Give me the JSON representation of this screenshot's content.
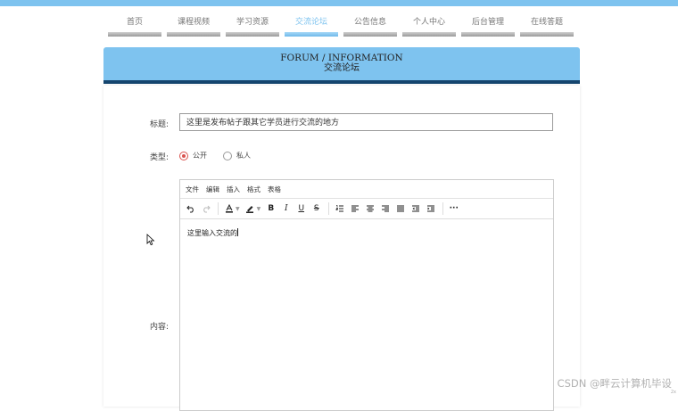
{
  "nav": {
    "items": [
      {
        "label": "首页",
        "active": false
      },
      {
        "label": "课程视频",
        "active": false
      },
      {
        "label": "学习资源",
        "active": false
      },
      {
        "label": "交流论坛",
        "active": true
      },
      {
        "label": "公告信息",
        "active": false
      },
      {
        "label": "个人中心",
        "active": false
      },
      {
        "label": "后台管理",
        "active": false
      },
      {
        "label": "在线答题",
        "active": false
      }
    ]
  },
  "banner": {
    "title_en": "FORUM / INFORMATION",
    "title_cn": "交流论坛"
  },
  "form": {
    "title_label": "标题:",
    "title_value": "这里是发布帖子跟其它学员进行交流的地方",
    "type_label": "类型:",
    "type_options": [
      {
        "label": "公开",
        "checked": true
      },
      {
        "label": "私人",
        "checked": false
      }
    ],
    "content_label": "内容:"
  },
  "editor": {
    "menus": [
      "文件",
      "编辑",
      "插入",
      "格式",
      "表格"
    ],
    "body_text": "这里输入交流的"
  },
  "colors": {
    "accent": "#7ec3ef",
    "banner_dark": "#15456e",
    "radio_checked": "#d9534f"
  },
  "watermark": "CSDN @畔云计算机毕设",
  "corner_mark": "2x"
}
